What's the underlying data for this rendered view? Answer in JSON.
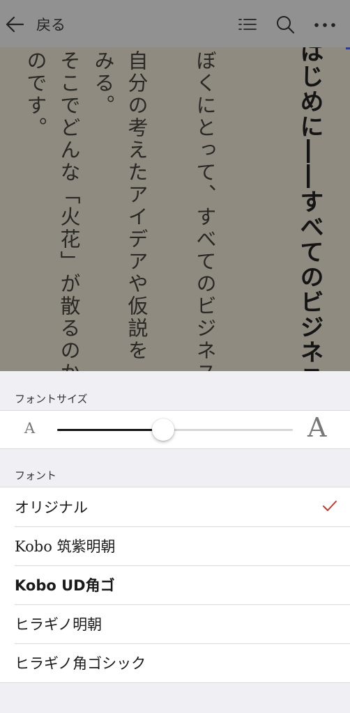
{
  "topbar": {
    "back_label": "戻る",
    "icons": [
      "arrow-left-icon",
      "list-icon",
      "search-icon",
      "more-icon"
    ]
  },
  "page": {
    "columns": [
      {
        "text": "はじめに――すべてのビジネスは「",
        "style": "heading"
      },
      {
        "text": "ぼくにとって、すべてのビジネスは「",
        "style": "body"
      },
      {
        "text": "自分の考えたアイデアや仮説を「世の",
        "style": "body"
      },
      {
        "text": "みる。",
        "style": "body"
      },
      {
        "text": "そこでどんな「火花」が散るのか、「",
        "style": "body"
      },
      {
        "text": "のです。",
        "style": "body"
      }
    ]
  },
  "settings": {
    "font_size_label": "フォントサイズ",
    "size_small_glyph": "A",
    "size_large_glyph": "A",
    "font_size_level": 0.45,
    "font_label": "フォント",
    "fonts": [
      {
        "name": "オリジナル",
        "selected": true
      },
      {
        "name": "Kobo 筑紫明朝",
        "selected": false
      },
      {
        "name": "Kobo UD角ゴ",
        "selected": false
      },
      {
        "name": "ヒラギノ明朝",
        "selected": false
      },
      {
        "name": "ヒラギノ角ゴシック",
        "selected": false
      }
    ]
  },
  "colors": {
    "check": "#c0392b",
    "slider_fill": "#111111",
    "page_dim": "#8f8b80",
    "topbar_dim": "#919191"
  }
}
